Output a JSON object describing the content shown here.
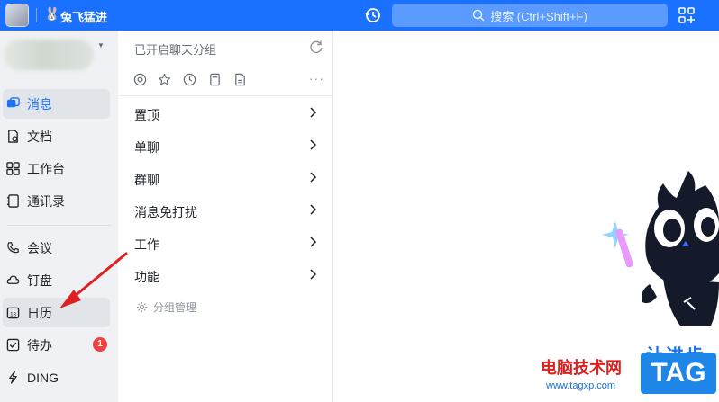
{
  "topbar": {
    "org_name": "兔飞猛进",
    "search_placeholder": "搜索 (Ctrl+Shift+F)",
    "accent": "#1a70ff"
  },
  "sidebar": {
    "items": [
      {
        "label": "消息",
        "icon": "message-icon",
        "active": true
      },
      {
        "label": "文档",
        "icon": "document-icon"
      },
      {
        "label": "工作台",
        "icon": "workbench-icon"
      },
      {
        "label": "通讯录",
        "icon": "contacts-icon"
      },
      {
        "label": "会议",
        "icon": "meeting-icon"
      },
      {
        "label": "钉盘",
        "icon": "cloud-drive-icon"
      },
      {
        "label": "日历",
        "icon": "calendar-icon"
      },
      {
        "label": "待办",
        "icon": "todo-icon",
        "badge": "1"
      },
      {
        "label": "DING",
        "icon": "ding-icon"
      }
    ]
  },
  "middle": {
    "header": "已开启聊天分组",
    "filters": [
      "at-icon",
      "star-icon",
      "clock-icon",
      "file-icon",
      "doc-icon",
      "more-icon"
    ],
    "more_label": "···",
    "groups": [
      {
        "label": "置顶"
      },
      {
        "label": "单聊"
      },
      {
        "label": "群聊"
      },
      {
        "label": "消息免打扰"
      },
      {
        "label": "工作"
      },
      {
        "label": "功能"
      }
    ],
    "manage_label": "分组管理"
  },
  "content": {
    "slogan": "让进步发"
  },
  "watermark": {
    "site_text": "电脑技术网",
    "url": "www.tagxp.com",
    "tag": "TAG"
  }
}
